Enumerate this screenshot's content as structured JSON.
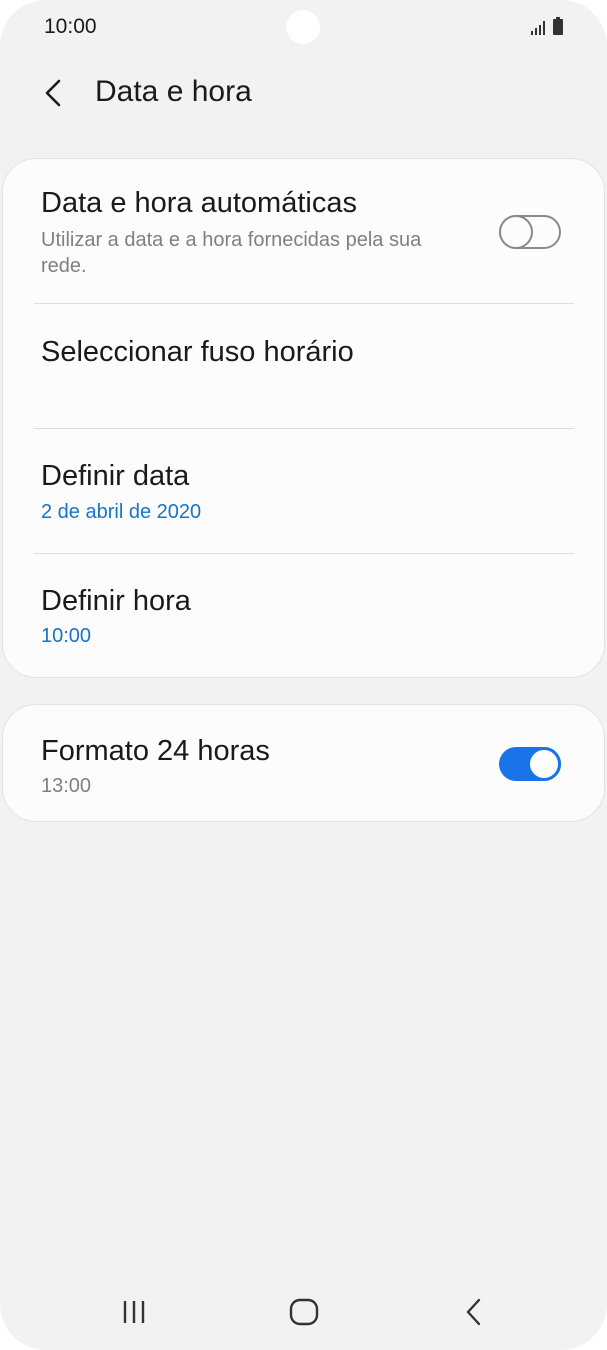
{
  "status_bar": {
    "time": "10:00",
    "icons": [
      "signal-icon",
      "battery-icon"
    ]
  },
  "header": {
    "title": "Data e hora",
    "back_icon": "chevron-left-icon"
  },
  "settings": {
    "auto_datetime": {
      "title": "Data e hora automáticas",
      "subtitle": "Utilizar a data e a hora fornecidas pela sua rede.",
      "enabled": false
    },
    "timezone": {
      "title": "Seleccionar fuso horário"
    },
    "set_date": {
      "title": "Definir data",
      "value": "2 de abril de 2020"
    },
    "set_time": {
      "title": "Definir hora",
      "value": "10:00"
    },
    "format_24h": {
      "title": "Formato 24 horas",
      "subtitle": "13:00",
      "enabled": true
    }
  },
  "colors": {
    "accent": "#1a73e8",
    "value_text": "#1a73c8",
    "background": "#f2f2f2",
    "card": "#fcfcfc"
  },
  "nav_bar": {
    "icons": [
      "recent-apps-icon",
      "home-icon",
      "back-icon"
    ]
  }
}
